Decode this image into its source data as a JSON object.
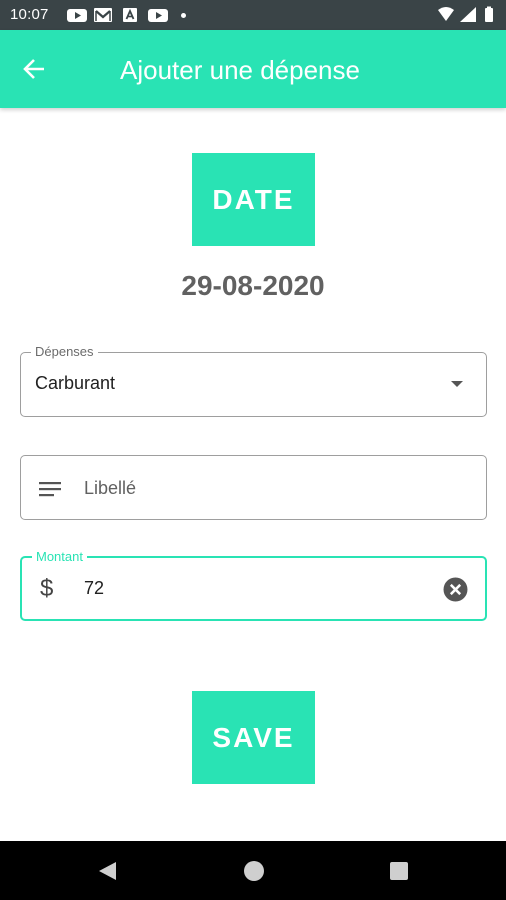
{
  "status_bar": {
    "time": "10:07",
    "notification_icons": [
      "youtube-icon",
      "gmail-icon",
      "text-icon",
      "youtube-icon",
      "dot-icon"
    ],
    "system_icons": [
      "wifi-icon",
      "signal-icon",
      "battery-icon"
    ]
  },
  "app_bar": {
    "title": "Ajouter une dépense",
    "back_icon": "arrow-left-icon",
    "color": "#29e3b4"
  },
  "date_button": {
    "label": "DATE"
  },
  "selected_date": "29-08-2020",
  "expense_type": {
    "label": "Dépenses",
    "value": "Carburant",
    "icon": "dropdown-arrow-icon"
  },
  "description": {
    "placeholder": "Libellé",
    "value": "",
    "icon": "subject-lines-icon"
  },
  "amount": {
    "label": "Montant",
    "value": "72",
    "prefix_icon": "dollar-icon",
    "suffix_icon": "clear-icon"
  },
  "save_button": {
    "label": "SAVE"
  },
  "nav_bar": {
    "icons": [
      "nav-back-icon",
      "nav-home-icon",
      "nav-recents-icon"
    ]
  }
}
